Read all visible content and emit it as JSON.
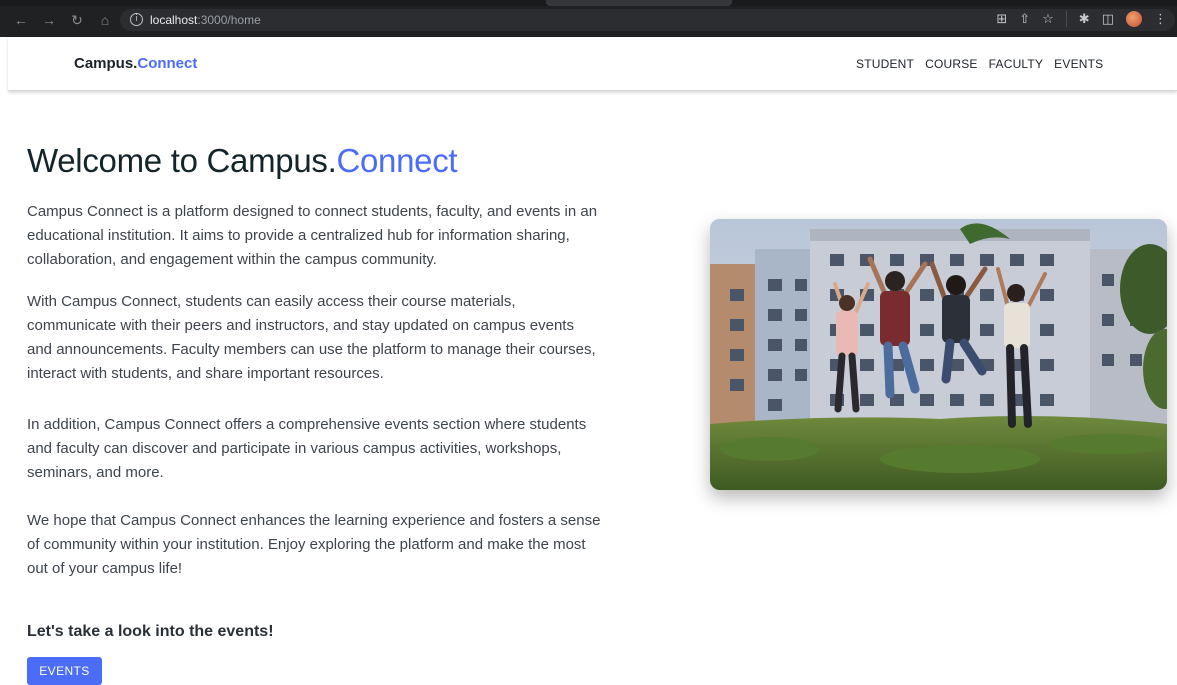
{
  "browser": {
    "url_host": "localhost",
    "url_path": ":3000/home"
  },
  "header": {
    "brand_main": "Campus.",
    "brand_accent": "Connect",
    "nav": [
      "STUDENT",
      "COURSE",
      "FACULTY",
      "EVENTS"
    ]
  },
  "hero": {
    "title_main": "Welcome to Campus.",
    "title_accent": "Connect"
  },
  "paragraphs": [
    "Campus Connect is a platform designed to connect students, faculty, and events in an educational institution. It aims to provide a centralized hub for information sharing, collaboration, and engagement within the campus community.",
    "With Campus Connect, students can easily access their course materials, communicate with their peers and instructors, and stay updated on campus events and announcements. Faculty members can use the platform to manage their courses, interact with students, and share important resources.",
    "In addition, Campus Connect offers a comprehensive events section where students and faculty can discover and participate in various campus activities, workshops, seminars, and more.",
    "We hope that Campus Connect enhances the learning experience and fosters a sense of community within your institution. Enjoy exploring the platform and make the most out of your campus life!"
  ],
  "events_section": {
    "heading": "Let's take a look into the events!",
    "button_label": "EVENTS"
  },
  "colors": {
    "accent": "#4a6cf7",
    "heading": "#13252a",
    "chrome_bg": "#1f2123"
  },
  "icons": {
    "back": "back-arrow-icon",
    "forward": "forward-arrow-icon",
    "reload": "reload-icon",
    "home": "home-icon",
    "site_info": "info-icon",
    "install": "install-icon",
    "share": "share-icon",
    "bookmark": "star-icon",
    "extensions": "puzzle-icon",
    "sidepanel": "side-panel-icon",
    "profile": "profile-avatar",
    "menu": "kebab-menu-icon"
  }
}
